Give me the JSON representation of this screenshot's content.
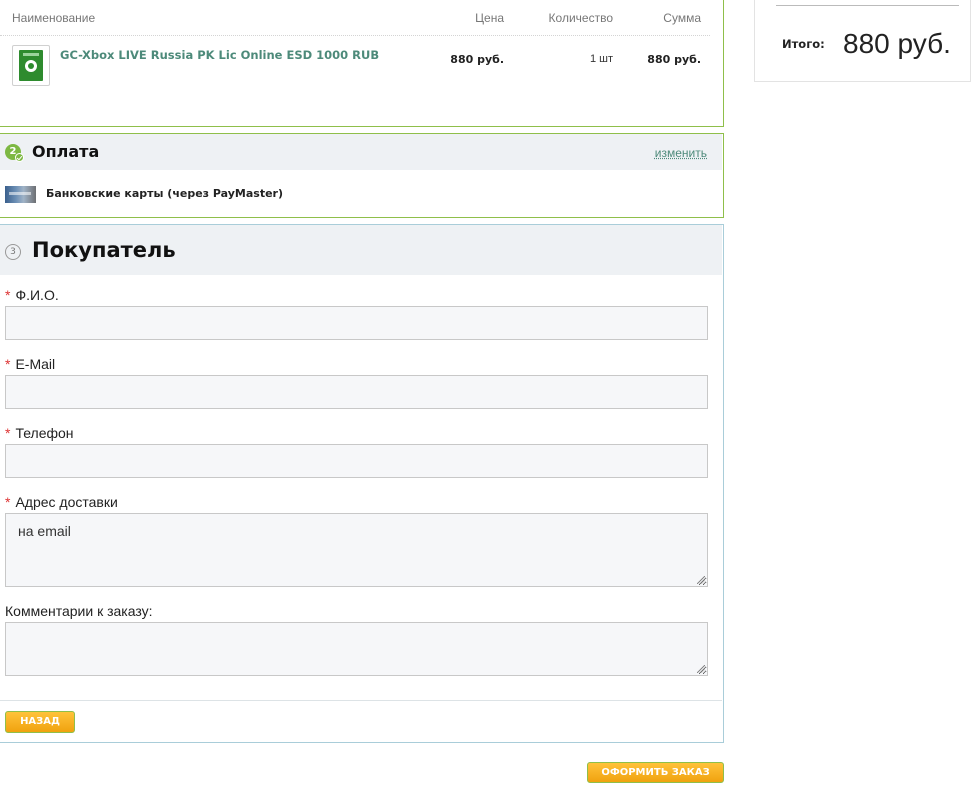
{
  "order": {
    "columns": {
      "name": "Наименование",
      "price": "Цена",
      "qty": "Количество",
      "sum": "Сумма"
    },
    "items": [
      {
        "name": "GC-Xbox LIVE Russia PK Lic Online ESD 1000 RUB",
        "price": "880 руб.",
        "qty": "1 шт",
        "sum": "880 руб.",
        "icon": "xbox-gift-card-icon"
      }
    ]
  },
  "payment": {
    "step": "2",
    "title": "Оплата",
    "change_label": "изменить",
    "method": "Банковские карты (через PayMaster)",
    "icon": "bank-cards-icon"
  },
  "buyer": {
    "step": "3",
    "title": "Покупатель",
    "fields": {
      "fio": {
        "label": "Ф.И.О.",
        "value": "",
        "required": "*"
      },
      "email": {
        "label": "E-Mail",
        "value": "",
        "required": "*"
      },
      "phone": {
        "label": "Телефон",
        "value": "",
        "required": "*"
      },
      "address": {
        "label": "Адрес доставки",
        "value": "на email",
        "required": "*"
      },
      "comment": {
        "label": "Комментарии к заказу:",
        "value": ""
      }
    },
    "back_label": "НАЗАД"
  },
  "submit_label": "ОФОРМИТЬ ЗАКАЗ",
  "total": {
    "label": "Итого:",
    "value": "880 руб."
  },
  "colors": {
    "accent_green": "#8fbf4a",
    "button_orange": "#f0a20f",
    "link": "#4d8a7a",
    "required_red": "#dd3333"
  }
}
